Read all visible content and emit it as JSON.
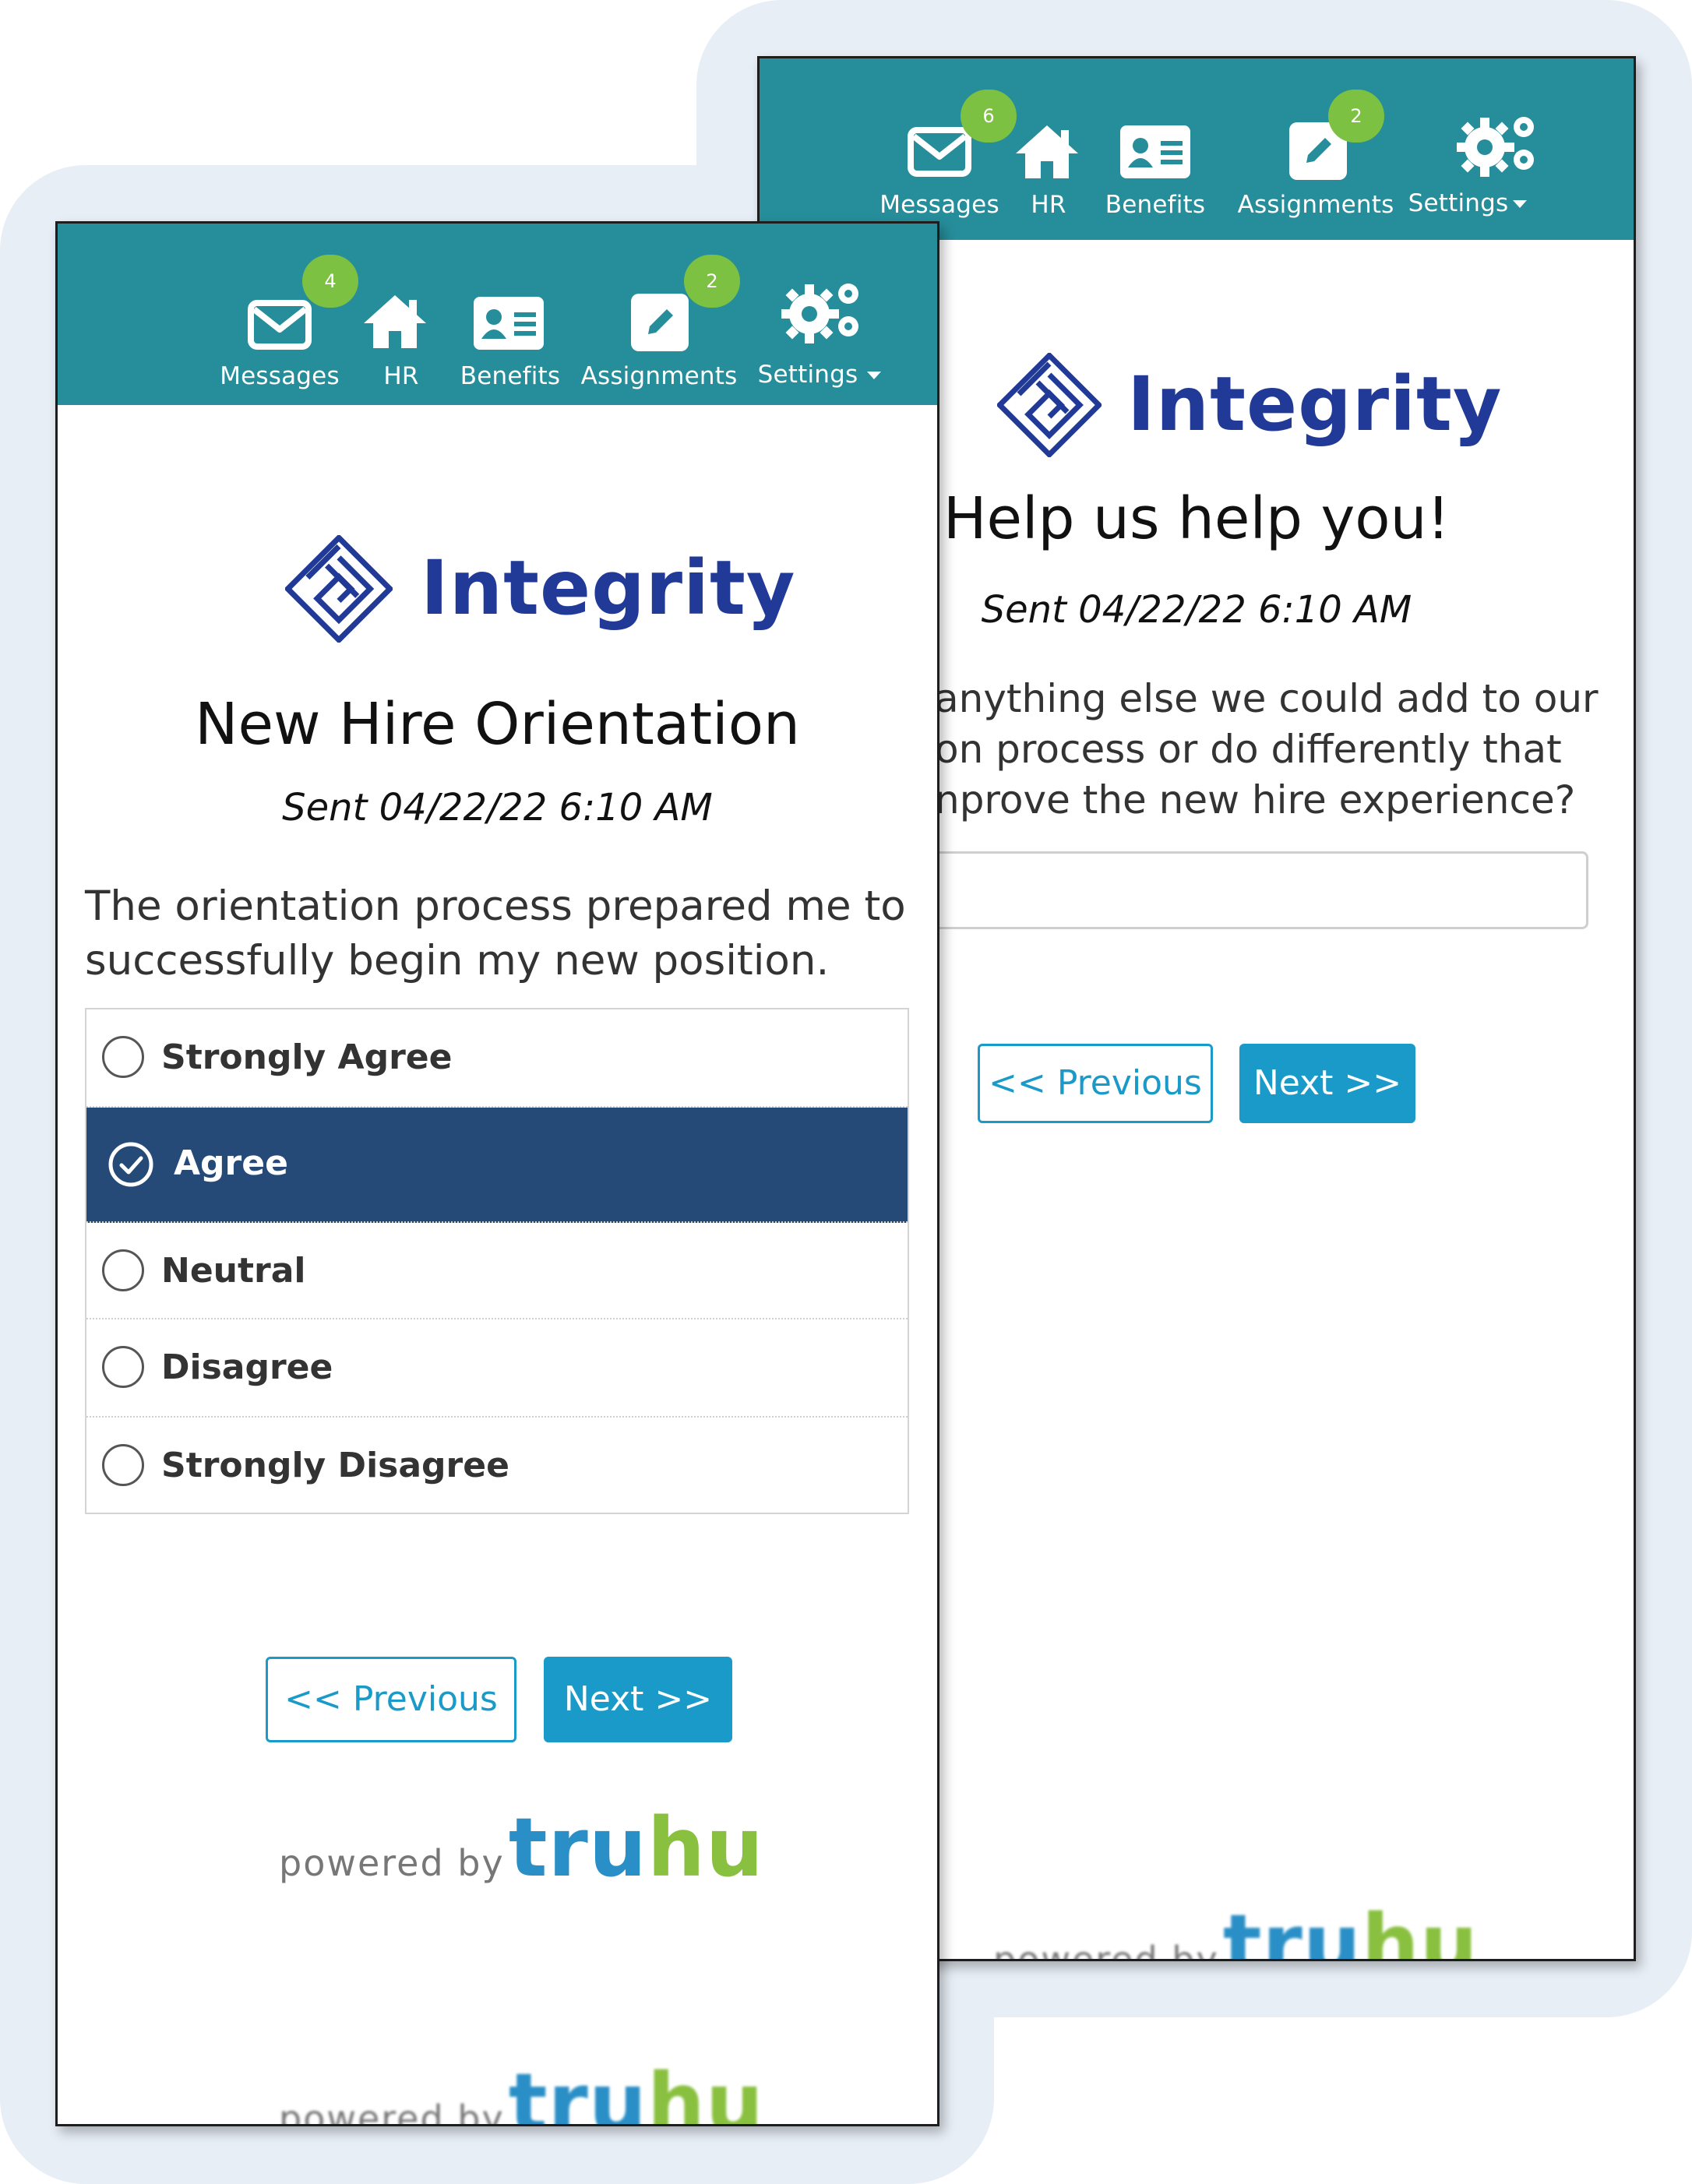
{
  "back_screen": {
    "nav": {
      "messages": {
        "label": "Messages",
        "badge": "6"
      },
      "hr": {
        "label": "HR"
      },
      "benefits": {
        "label": "Benefits"
      },
      "assignments": {
        "label": "Assignments",
        "badge": "2"
      },
      "settings": {
        "label": "Settings"
      }
    },
    "logo_text": "Integrity",
    "title": "Help us help you!",
    "sent": "Sent 04/22/22 6:10 AM",
    "question_lines": [
      "anything else we could add to our",
      "on process or do differently that",
      "nprove the new hire experience?"
    ],
    "prev_label": "<< Previous",
    "next_label": "Next >>",
    "powered_by": "powered by",
    "brand_tru": "tru",
    "brand_hu": "hu"
  },
  "front_screen": {
    "nav": {
      "messages": {
        "label": "Messages",
        "badge": "4"
      },
      "hr": {
        "label": "HR"
      },
      "benefits": {
        "label": "Benefits"
      },
      "assignments": {
        "label": "Assignments",
        "badge": "2"
      },
      "settings": {
        "label": "Settings"
      }
    },
    "logo_text": "Integrity",
    "title": "New Hire Orientation",
    "sent": "Sent 04/22/22 6:10 AM",
    "question": "The orientation process prepared me to successfully begin my new position.",
    "options": [
      {
        "label": "Strongly Agree",
        "selected": false
      },
      {
        "label": "Agree",
        "selected": true
      },
      {
        "label": "Neutral",
        "selected": false
      },
      {
        "label": "Disagree",
        "selected": false
      },
      {
        "label": "Strongly Disagree",
        "selected": false
      }
    ],
    "prev_label": "<< Previous",
    "next_label": "Next >>",
    "powered_by": "powered by",
    "brand_tru": "tru",
    "brand_hu": "hu"
  },
  "colors": {
    "topbar": "#268d9a",
    "badge": "#7cc142",
    "selected_option": "#264a78",
    "button": "#1a9ac9",
    "logo": "#223a97",
    "background_shape": "#e8eef6"
  },
  "icons": [
    "envelope-icon",
    "home-icon",
    "id-card-icon",
    "pencil-icon",
    "gears-icon",
    "caret-down-icon",
    "check-circle-icon",
    "integrity-logo"
  ]
}
